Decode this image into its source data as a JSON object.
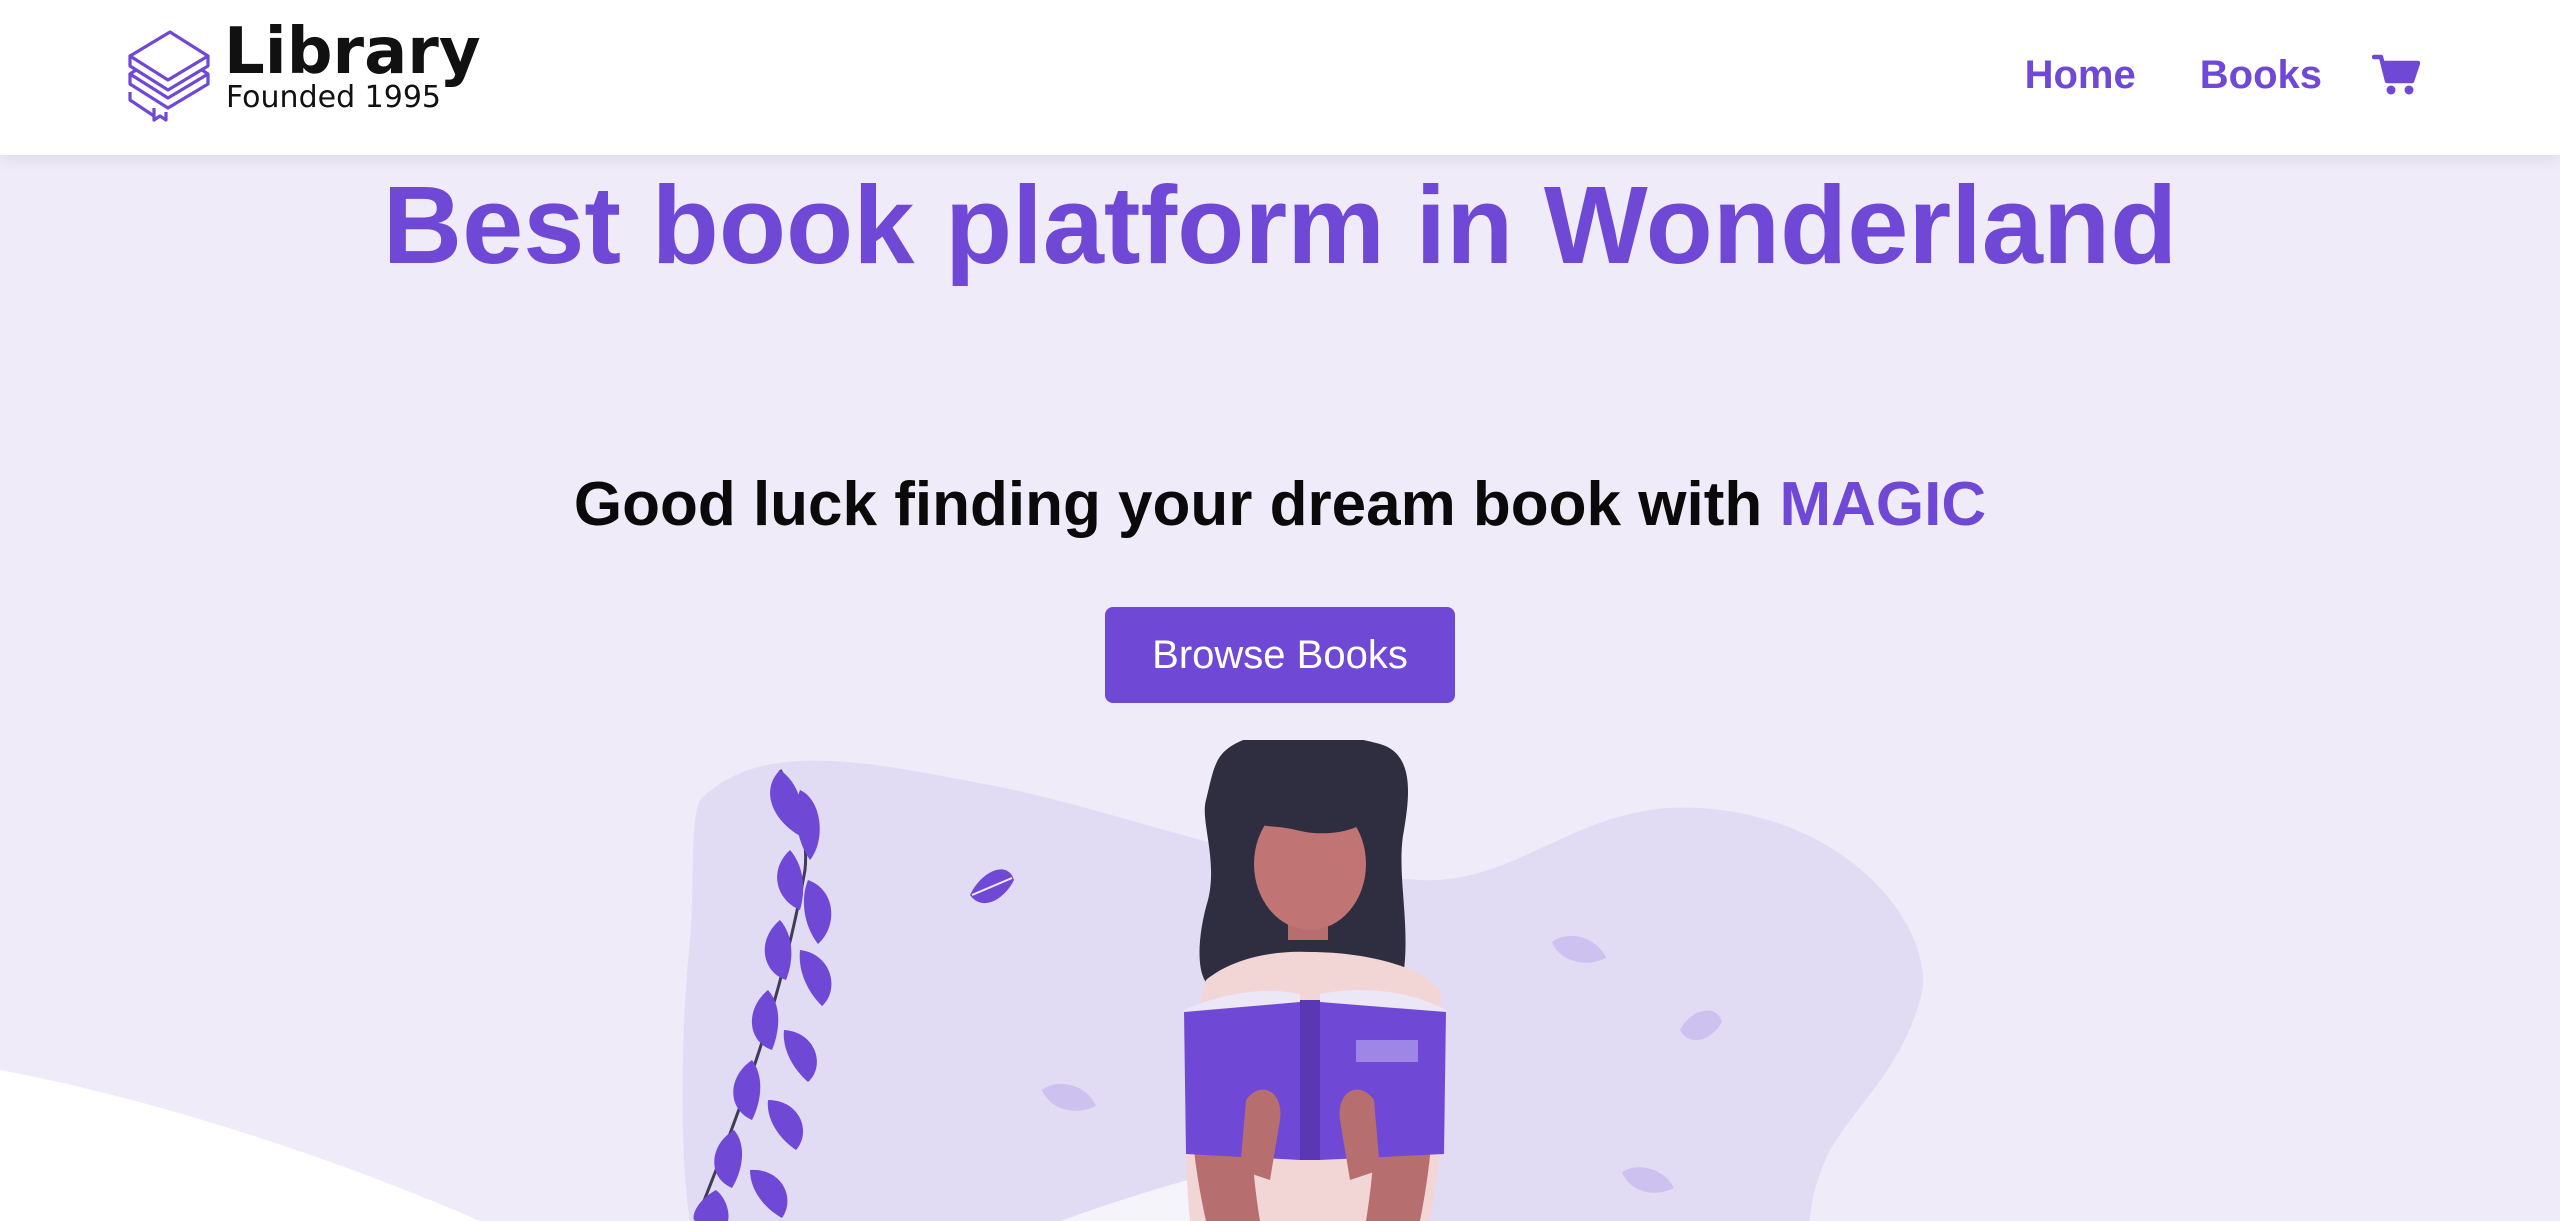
{
  "brand": {
    "name": "Library",
    "subtitle": "Founded 1995",
    "icon": "stacked-books-icon"
  },
  "nav": {
    "links": [
      {
        "label": "Home"
      },
      {
        "label": "Books"
      }
    ],
    "cart_icon": "shopping-cart-icon"
  },
  "hero": {
    "title": "Best book platform in Wonderland",
    "subtitle_prefix": "Good luck finding your dream book with ",
    "subtitle_highlight": "MAGIC",
    "cta_label": "Browse Books"
  },
  "illustration": "woman-reading-book-illustration",
  "colors": {
    "accent": "#7048d6",
    "background": "#efebf8",
    "blob": "#e2dbf4",
    "text": "#0a0a0a"
  }
}
